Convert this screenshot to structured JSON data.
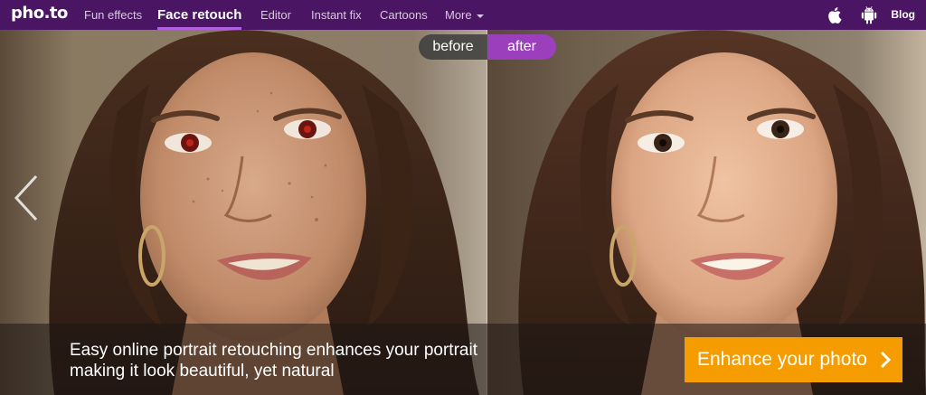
{
  "nav": {
    "logo": "pho.to",
    "items": [
      {
        "label": "Fun effects"
      },
      {
        "label": "Face retouch"
      },
      {
        "label": "Editor"
      },
      {
        "label": "Instant fix"
      },
      {
        "label": "Cartoons"
      },
      {
        "label": "More"
      }
    ],
    "icons": [
      "apple-icon",
      "android-icon"
    ],
    "blog_label": "Blog",
    "colors": {
      "bar": "#4a1563",
      "active_underline": "#b15ee0"
    }
  },
  "hero": {
    "toggle": {
      "before_label": "before",
      "after_label": "after"
    },
    "tagline_line1": "Easy online portrait retouching enhances your portrait",
    "tagline_line2": "making it look beautiful, yet natural",
    "cta_label": "Enhance your photo",
    "colors": {
      "cta": "#f59c00",
      "after_toggle": "#9b3fbd"
    }
  }
}
